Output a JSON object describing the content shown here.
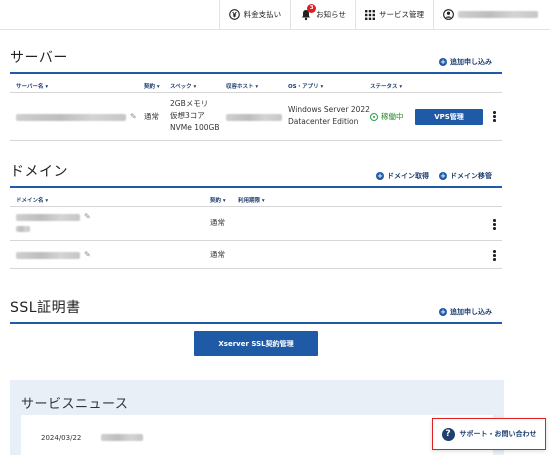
{
  "topnav": {
    "billing": "料金支払い",
    "notifications": "お知らせ",
    "notification_count": "3",
    "service_management": "サービス管理"
  },
  "server": {
    "title": "サーバー",
    "add_link": "追加申し込み",
    "columns": [
      "サーバー名",
      "契約",
      "スペック",
      "収容ホスト",
      "OS・アプリ",
      "ステータス"
    ],
    "row": {
      "contract": "通常",
      "spec_1": "2GBメモリ",
      "spec_2": "仮想3コア",
      "spec_3": "NVMe 100GB",
      "os_1": "Windows Server 2022",
      "os_2": "Datacenter Edition",
      "status": "稼働中",
      "button": "VPS管理"
    }
  },
  "domain": {
    "title": "ドメイン",
    "link_acquire": "ドメイン取得",
    "link_transfer": "ドメイン移管",
    "columns": [
      "ドメイン名",
      "契約",
      "利用期限"
    ],
    "rows": [
      {
        "contract": "通常"
      },
      {
        "contract": "通常"
      }
    ]
  },
  "ssl": {
    "title": "SSL証明書",
    "add_link": "追加申し込み",
    "button": "Xserver SSL契約管理"
  },
  "news": {
    "title": "サービスニュース",
    "date": "2024/03/22"
  },
  "support": {
    "label": "サポート・お問い合わせ"
  }
}
